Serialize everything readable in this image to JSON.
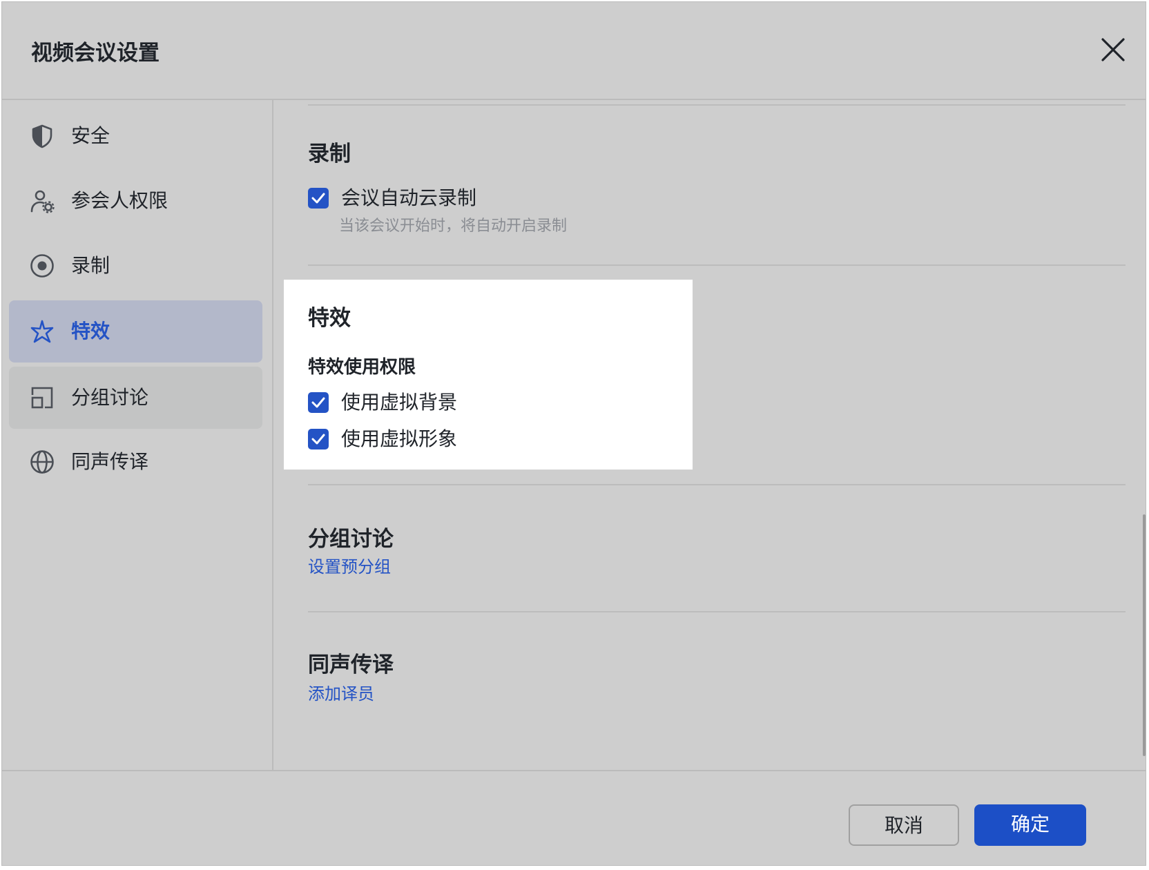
{
  "dialog": {
    "title": "视频会议设置"
  },
  "sidebar": {
    "items": [
      {
        "label": "安全",
        "icon": "shield-icon"
      },
      {
        "label": "参会人权限",
        "icon": "user-gear-icon"
      },
      {
        "label": "录制",
        "icon": "record-icon"
      },
      {
        "label": "特效",
        "icon": "sparkle-icon",
        "state": "selected"
      },
      {
        "label": "分组讨论",
        "icon": "breakout-icon",
        "state": "hovered"
      },
      {
        "label": "同声传译",
        "icon": "globe-icon"
      }
    ]
  },
  "sections": {
    "recording": {
      "title": "录制",
      "auto_cloud": {
        "label": "会议自动云录制",
        "description": "当该会议开始时，将自动开启录制",
        "checked": true
      }
    },
    "effects": {
      "title": "特效",
      "permission_title": "特效使用权限",
      "virtual_background": {
        "label": "使用虚拟背景",
        "checked": true
      },
      "virtual_avatar": {
        "label": "使用虚拟形象",
        "checked": true
      }
    },
    "breakout": {
      "title": "分组讨论",
      "link": "设置预分组"
    },
    "interpretation": {
      "title": "同声传译",
      "link": "添加译员"
    }
  },
  "footer": {
    "cancel": "取消",
    "confirm": "确定"
  },
  "colors": {
    "accent": "#2453c5",
    "primary_button": "#1c4fc6",
    "overlay": "#cecece",
    "highlight": "#ffffff"
  }
}
